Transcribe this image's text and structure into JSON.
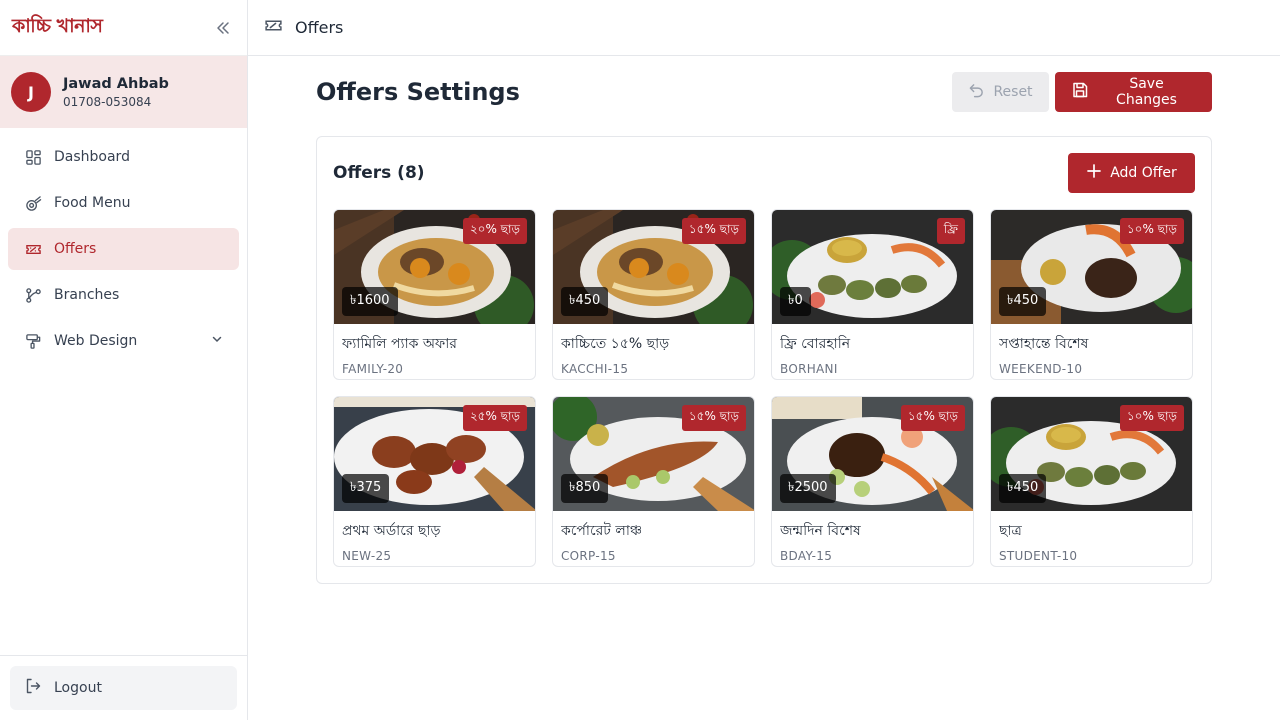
{
  "brand": {
    "logo_text": "কাচ্চি খানাস"
  },
  "user": {
    "initial": "J",
    "name": "Jawad Ahbab",
    "phone": "01708-053084"
  },
  "sidebar": {
    "items": [
      {
        "label": "Dashboard",
        "icon": "dashboard-icon"
      },
      {
        "label": "Food Menu",
        "icon": "food-menu-icon"
      },
      {
        "label": "Offers",
        "icon": "ticket-icon"
      },
      {
        "label": "Branches",
        "icon": "branches-icon"
      },
      {
        "label": "Web Design",
        "icon": "paint-roller-icon"
      }
    ],
    "active": "Offers",
    "logout_label": "Logout"
  },
  "topbar": {
    "title": "Offers"
  },
  "main": {
    "title": "Offers Settings",
    "reset_label": "Reset",
    "save_label": "Save Changes",
    "panel_title": "Offers (8)",
    "add_label": "Add Offer"
  },
  "colors": {
    "accent": "#b0272d",
    "accent_light": "#f6e4e4"
  },
  "offers": [
    {
      "badge": "২০% ছাড়",
      "price": "৳1600",
      "name": "ফ্যামিলি প্যাক অফার",
      "code": "FAMILY-20",
      "dish": "kacchi"
    },
    {
      "badge": "১৫% ছাড়",
      "price": "৳450",
      "name": "কাচ্চিতে ১৫% ছাড়",
      "code": "KACCHI-15",
      "dish": "kacchi"
    },
    {
      "badge": "ফ্রি",
      "price": "৳0",
      "name": "ফ্রি বোরহানি",
      "code": "BORHANI",
      "dish": "kebab"
    },
    {
      "badge": "১০% ছাড়",
      "price": "৳450",
      "name": "সপ্তাহান্তে বিশেষ",
      "code": "WEEKEND-10",
      "dish": "steak"
    },
    {
      "badge": "২৫% ছাড়",
      "price": "৳375",
      "name": "প্রথম অর্ডারে ছাড়",
      "code": "NEW-25",
      "dish": "chicken"
    },
    {
      "badge": "১৫% ছাড়",
      "price": "৳850",
      "name": "কর্পোরেট লাঞ্চ",
      "code": "CORP-15",
      "dish": "fish"
    },
    {
      "badge": "১৫% ছাড়",
      "price": "৳2500",
      "name": "জন্মদিন বিশেষ",
      "code": "BDAY-15",
      "dish": "grill"
    },
    {
      "badge": "১০% ছাড়",
      "price": "৳450",
      "name": "ছাত্র",
      "code": "STUDENT-10",
      "dish": "kebab"
    }
  ]
}
